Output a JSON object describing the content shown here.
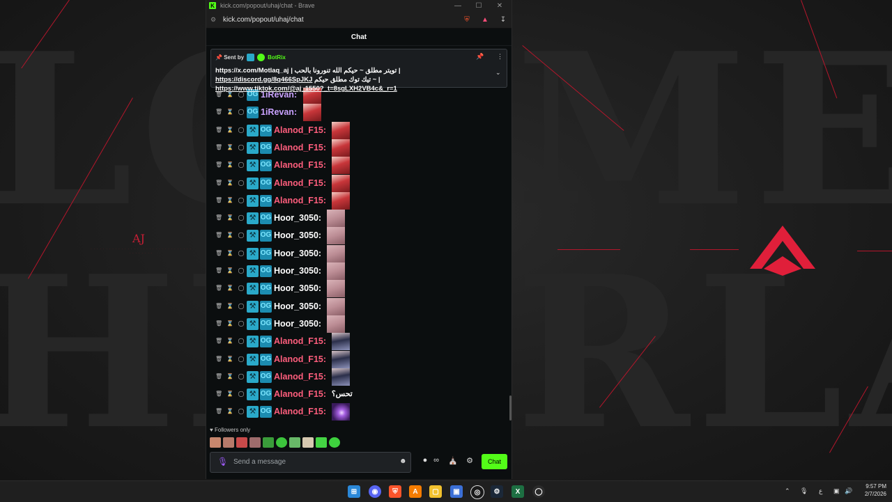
{
  "browser": {
    "title": "kick.com/popout/uhaj/chat - Brave",
    "url": "kick.com/popout/uhaj/chat",
    "minimize_icon": "minimize-icon",
    "maximize_icon": "maximize-icon",
    "close_icon": "close-icon"
  },
  "chat": {
    "header": "Chat",
    "pinned": {
      "sent_by_label": "Sent by",
      "user": "BotRix",
      "message_part1": "https://x.com/Motlaq_aj | تويتر مطلق ~ حيكم الله تنورونا بالحب | ",
      "link_discord": "https://discord.gg/8q466SpJKJ",
      "message_part2": "تيك توك مطلق حيكم ~ | ",
      "link_tiktok": "https://www.tiktok.com/@aj_1550?_t=8sgLXH2VB4c&_r=1"
    },
    "messages": [
      {
        "user": "1iRevan:",
        "color": "#c9a2ff",
        "og_only": true,
        "emote": "em-red"
      },
      {
        "user": "1iRevan:",
        "color": "#c9a2ff",
        "og_only": true,
        "emote": "em-red"
      },
      {
        "user": "Alanod_F15:",
        "color": "#ff5e7d",
        "og_only": false,
        "emote": "em-red"
      },
      {
        "user": "Alanod_F15:",
        "color": "#ff5e7d",
        "og_only": false,
        "emote": "em-red"
      },
      {
        "user": "Alanod_F15:",
        "color": "#ff5e7d",
        "og_only": false,
        "emote": "em-red"
      },
      {
        "user": "Alanod_F15:",
        "color": "#ff5e7d",
        "og_only": false,
        "emote": "em-red"
      },
      {
        "user": "Alanod_F15:",
        "color": "#ff5e7d",
        "og_only": false,
        "emote": "em-red"
      },
      {
        "user": "Hoor_3050:",
        "color": "#ffffff",
        "og_only": false,
        "emote": "em-pink"
      },
      {
        "user": "Hoor_3050:",
        "color": "#ffffff",
        "og_only": false,
        "emote": "em-pink"
      },
      {
        "user": "Hoor_3050:",
        "color": "#ffffff",
        "og_only": false,
        "emote": "em-pink"
      },
      {
        "user": "Hoor_3050:",
        "color": "#ffffff",
        "og_only": false,
        "emote": "em-pink"
      },
      {
        "user": "Hoor_3050:",
        "color": "#ffffff",
        "og_only": false,
        "emote": "em-pink"
      },
      {
        "user": "Hoor_3050:",
        "color": "#ffffff",
        "og_only": false,
        "emote": "em-pink"
      },
      {
        "user": "Hoor_3050:",
        "color": "#ffffff",
        "og_only": false,
        "emote": "em-pink"
      },
      {
        "user": "Alanod_F15:",
        "color": "#ff5e7d",
        "og_only": false,
        "emote": "em-dark"
      },
      {
        "user": "Alanod_F15:",
        "color": "#ff5e7d",
        "og_only": false,
        "emote": "em-dark"
      },
      {
        "user": "Alanod_F15:",
        "color": "#ff5e7d",
        "og_only": false,
        "emote": "em-dark"
      },
      {
        "user": "Alanod_F15:",
        "color": "#ff5e7d",
        "og_only": false,
        "text": "تحس؟"
      },
      {
        "user": "Alanod_F15:",
        "color": "#ff5e7d",
        "og_only": false,
        "emote": "em-purple"
      }
    ],
    "followers_only": "Followers only",
    "input_placeholder": "Send a message",
    "send_button": "Chat"
  },
  "background": {
    "brand": "AJ"
  },
  "taskbar": {
    "time": "9:57 PM",
    "date": "2/7/2026",
    "ime": "ع"
  },
  "colors": {
    "accent": "#53fc18",
    "brand_red": "#c81e35"
  }
}
